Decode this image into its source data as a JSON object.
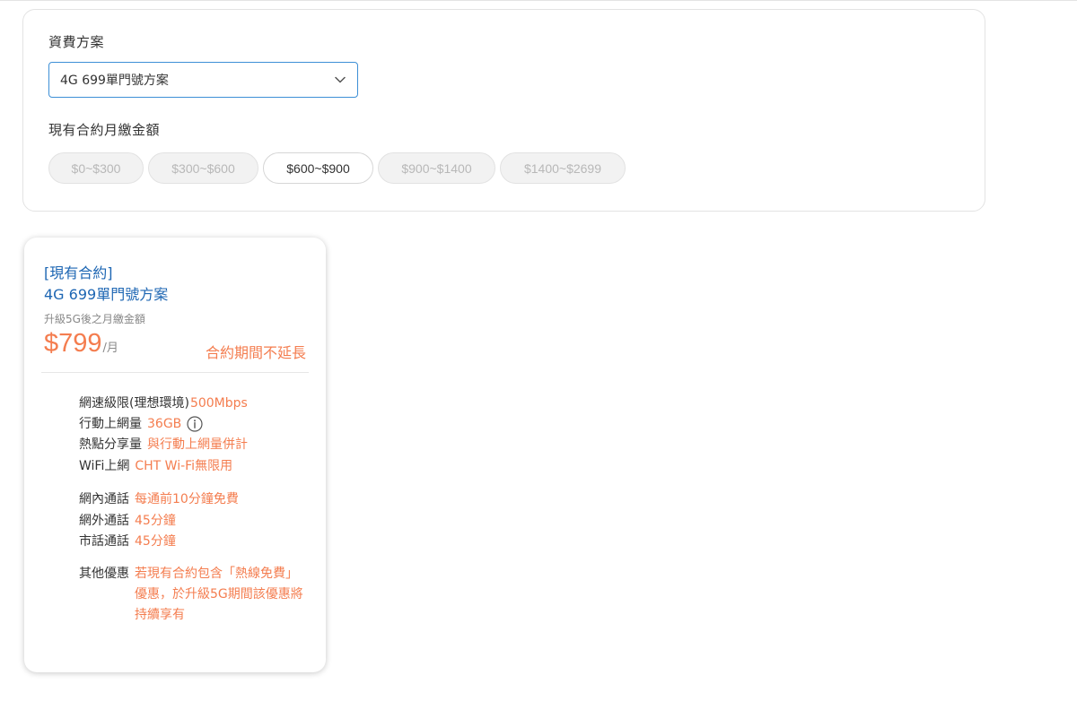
{
  "filter": {
    "plan_label": "資費方案",
    "plan_select": {
      "value": "4G 699單門號方案",
      "icon": "chevron-down-icon"
    },
    "fee_label": "現有合約月繳金額",
    "ranges": [
      {
        "label": "$0~$300",
        "state": "disabled"
      },
      {
        "label": "$300~$600",
        "state": "disabled"
      },
      {
        "label": "$600~$900",
        "state": "active"
      },
      {
        "label": "$900~$1400",
        "state": "disabled"
      },
      {
        "label": "$1400~$2699",
        "state": "disabled"
      }
    ]
  },
  "card": {
    "tag": "[現有合約]",
    "plan_name": "4G 699單門號方案",
    "sub_label": "升級5G後之月繳金額",
    "price": "$799",
    "price_unit": "/月",
    "contract_note": "合約期間不延長",
    "features": {
      "speed": {
        "label": "網速級限(理想環境)",
        "value": "500Mbps"
      },
      "data": {
        "label": "行動上網量",
        "value": "36GB",
        "icon": "info-icon"
      },
      "hotspot": {
        "label": "熱點分享量",
        "value": "與行動上網量併計"
      },
      "wifi": {
        "label": "WiFi上網",
        "value": "CHT Wi-Fi無限用"
      },
      "onnet": {
        "label": "網內通話",
        "value": "每通前10分鐘免費"
      },
      "offnet": {
        "label": "網外通話",
        "value": "45分鐘"
      },
      "local": {
        "label": "市話通話",
        "value": "45分鐘"
      },
      "other": {
        "label": "其他優惠",
        "value": "若現有合約包含「熱線免費」優惠，於升級5G期間該優惠將持續享有"
      }
    }
  },
  "colors": {
    "accent_orange": "#f47d4f",
    "link_blue": "#1d66b3",
    "select_border": "#3d8fd6"
  }
}
